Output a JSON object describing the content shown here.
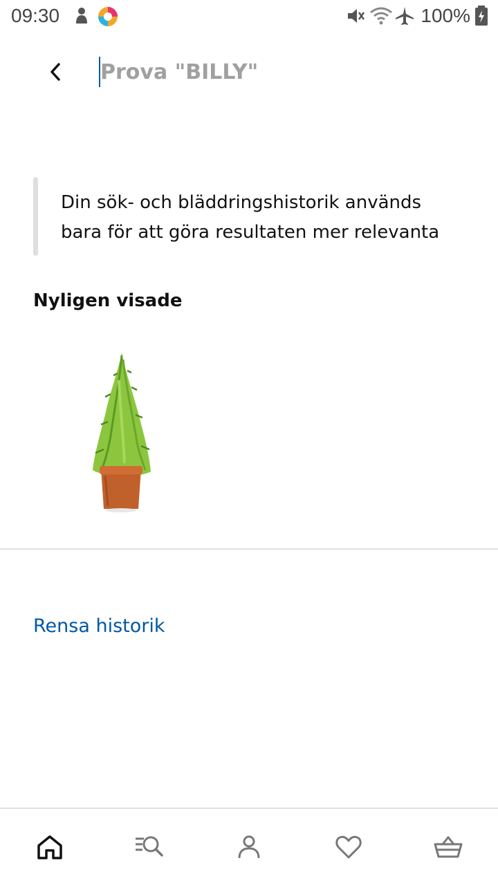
{
  "status_bar": {
    "time": "09:30",
    "battery": "100%",
    "icons": [
      "notification-icon",
      "app-icon",
      "mute-icon",
      "wifi-icon",
      "airplane-icon",
      "battery-icon"
    ]
  },
  "search": {
    "placeholder": "Prova \"BILLY\"",
    "value": ""
  },
  "info": {
    "text": "Din sök- och bläddringshistorik används bara för att göra resultaten mer relevanta"
  },
  "recent": {
    "title": "Nyligen visade",
    "items": [
      {
        "icon": "potted-cypress-plant-image"
      }
    ]
  },
  "actions": {
    "clear_history": "Rensa historik"
  },
  "bottom_nav": {
    "items": [
      {
        "icon": "home-icon",
        "active": true
      },
      {
        "icon": "search-browse-icon",
        "active": false
      },
      {
        "icon": "profile-icon",
        "active": false
      },
      {
        "icon": "heart-icon",
        "active": false
      },
      {
        "icon": "basket-icon",
        "active": false
      }
    ]
  },
  "colors": {
    "accent": "#0058a3",
    "placeholder": "#a0a0a0",
    "divider": "#e0e0e0",
    "icon_gray": "#666666"
  }
}
